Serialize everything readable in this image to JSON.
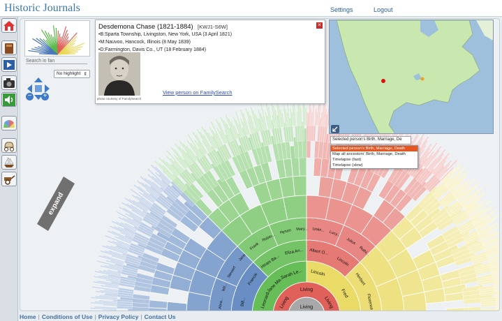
{
  "app": {
    "title": "Historic Journals"
  },
  "nav": {
    "settings": "Settings",
    "logout": "Logout"
  },
  "sidebar": {
    "items": [
      {
        "name": "home-icon"
      },
      {
        "name": "journal-book-icon"
      },
      {
        "name": "play-presentation-icon"
      },
      {
        "name": "camera-icon"
      },
      {
        "name": "sound-icon"
      },
      {
        "name": "fan-chart-view-icon"
      },
      {
        "name": "covered-wagon-icon"
      },
      {
        "name": "ship-icon"
      },
      {
        "name": "handcart-icon"
      }
    ]
  },
  "controls": {
    "search_placeholder": "Search in fan",
    "highlight_value": "No highlight",
    "expand_label": "expand"
  },
  "person": {
    "name": "Desdemona Chase (1821-1884)",
    "id": "[KWJ1-S6W]",
    "birth": "•B:Sparta Township, Livingston, New York, USA (3 April 1821)",
    "marriage": "•M:Nauvoo, Hancock, Illinois (8 May 1839)",
    "death": "•D:Farmington, Davis Co., UT (18 February 1884)",
    "photo_credit": "photo courtesy of FamilySearch",
    "link": "View person on FamilySearch",
    "close": "✕"
  },
  "map": {
    "select_value": "Selected person's Birth, Marriage, De",
    "options": [
      "Selected person's Birth, Marriage, Death",
      "Map all ancestors' Birth, Marriage, Death",
      "Timelapse (fast)",
      "Timelapse (slow)"
    ],
    "markers": [
      {
        "color": "#e01010"
      },
      {
        "color": "#f0a020"
      }
    ]
  },
  "fan": {
    "center_label": "Living",
    "ring1": [
      "Living",
      "Living",
      "Living"
    ],
    "ring2": [
      "Leonard",
      "Jane Ma...",
      "Sarah Le...",
      "Lincoln",
      "Fred"
    ],
    "ring3": [
      "Bill...",
      "Francis",
      "Hiram Ba...",
      "Eliza An...",
      "Albert O...",
      "Lincoln",
      "Herbert",
      "Florence"
    ],
    "ring4": [
      "Abra...",
      "Wil...",
      "Stewart",
      "Jane",
      "Frank",
      "Rober...",
      "Hyrum",
      "Mary...",
      "Unkn...",
      "Lucy...",
      "Julius",
      "Ruthi..."
    ],
    "colors": {
      "blue": "#4b78b8",
      "green": "#5ab84a",
      "red": "#e0605a",
      "yellow": "#e8d85a"
    }
  },
  "footer": {
    "links": [
      "Home",
      "Conditions of Use",
      "Privacy Policy",
      "Contact Us"
    ]
  }
}
